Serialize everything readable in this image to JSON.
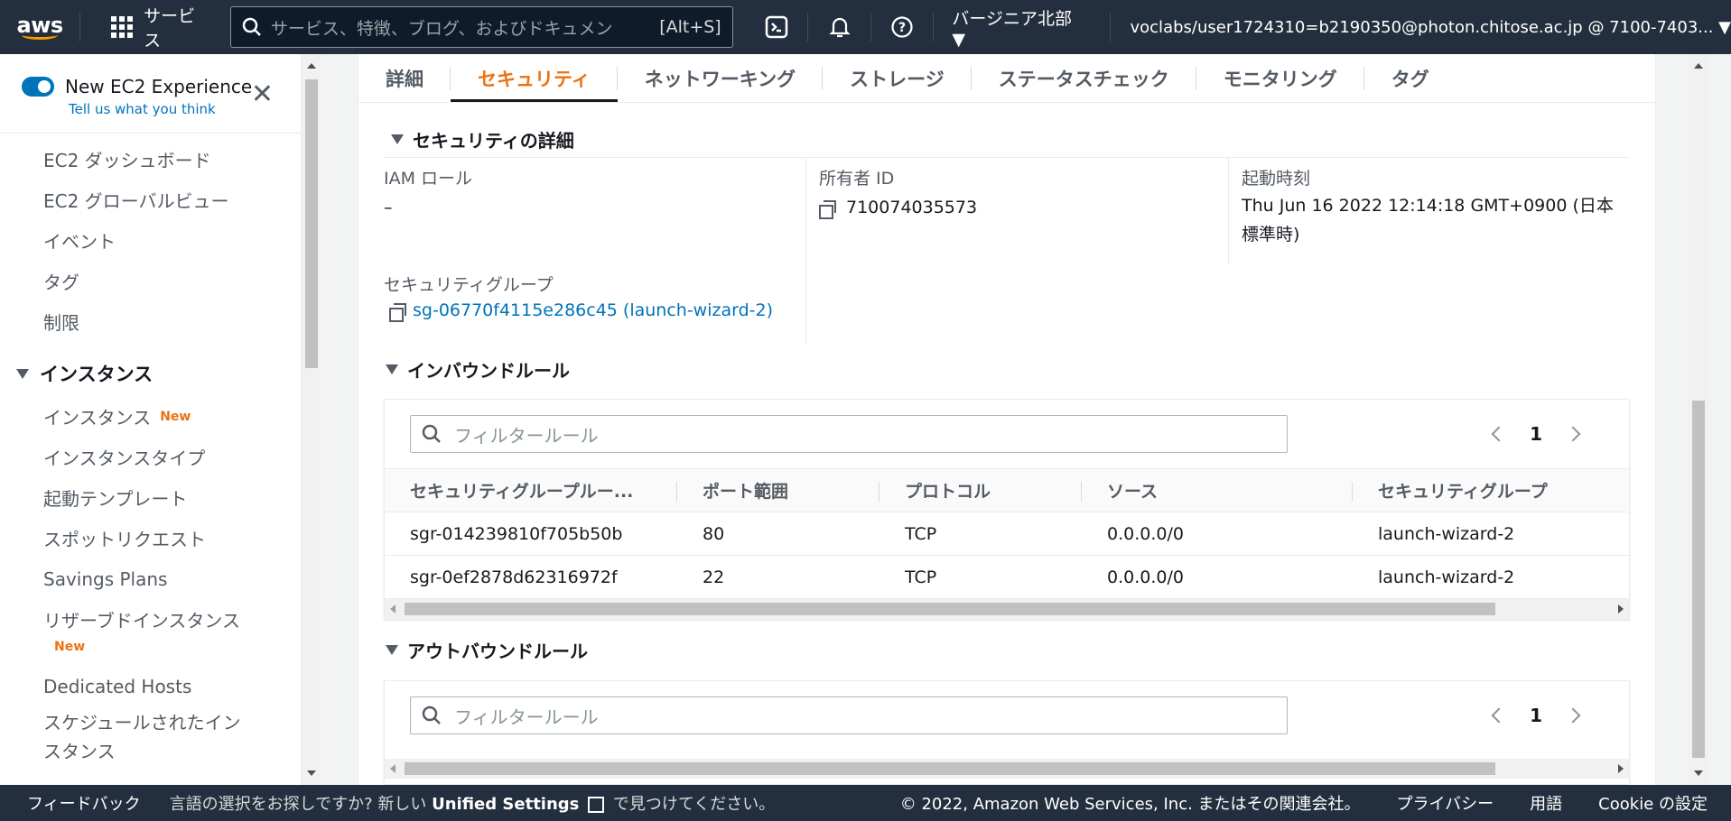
{
  "topnav": {
    "logo": "aws",
    "services_label": "サービス",
    "search_placeholder": "サービス、特徴、ブログ、およびドキュメン",
    "search_shortcut": "[Alt+S]",
    "region": "バージニア北部 ▼",
    "account": "voclabs/user1724310=b2190350@photon.chitose.ac.jp @ 7100-7403... ▼"
  },
  "sidebar": {
    "experience_label": "New EC2 Experience",
    "tell_us": "Tell us what you think",
    "items_top": [
      "EC2 ダッシュボード",
      "EC2 グローバルビュー",
      "イベント",
      "タグ",
      "制限"
    ],
    "section_instances": "インスタンス",
    "instance_items": {
      "instances": "インスタンス",
      "instances_badge": "New",
      "types": "インスタンスタイプ",
      "templates": "起動テンプレート",
      "spot": "スポットリクエスト",
      "savings": "Savings Plans",
      "reserved": "リザーブドインスタンス",
      "reserved_badge": "New",
      "dedicated": "Dedicated Hosts",
      "scheduled": "スケジュールされたインスタンス"
    }
  },
  "tabs": [
    "詳細",
    "セキュリティ",
    "ネットワーキング",
    "ストレージ",
    "ステータスチェック",
    "モニタリング",
    "タグ"
  ],
  "security_details": {
    "heading": "セキュリティの詳細",
    "iam_label": "IAM ロール",
    "iam_value": "–",
    "owner_label": "所有者 ID",
    "owner_value": "710074035573",
    "launch_label": "起動時刻",
    "launch_value": "Thu Jun 16 2022 12:14:18 GMT+0900 (日本標準時)",
    "sg_label": "セキュリティグループ",
    "sg_value": "sg-06770f4115e286c45 (launch-wizard-2)"
  },
  "inbound": {
    "heading": "インバウンドルール",
    "filter_placeholder": "フィルタールール",
    "page": "1",
    "columns": [
      "セキュリティグループルー...",
      "ポート範囲",
      "プロトコル",
      "ソース",
      "セキュリティグループ"
    ],
    "rows": [
      [
        "sgr-014239810f705b50b",
        "80",
        "TCP",
        "0.0.0.0/0",
        "launch-wizard-2"
      ],
      [
        "sgr-0ef2878d62316972f",
        "22",
        "TCP",
        "0.0.0.0/0",
        "launch-wizard-2"
      ]
    ]
  },
  "outbound": {
    "heading": "アウトバウンドルール",
    "filter_placeholder": "フィルタールール",
    "page": "1"
  },
  "footer": {
    "feedback": "フィードバック",
    "lang_prefix": "言語の選択をお探しですか? 新しい",
    "unified": "Unified Settings",
    "lang_suffix": "で見つけてください。",
    "copyright": "© 2022, Amazon Web Services, Inc. またはその関連会社。",
    "privacy": "プライバシー",
    "terms": "用語",
    "cookie": "Cookie の設定"
  }
}
